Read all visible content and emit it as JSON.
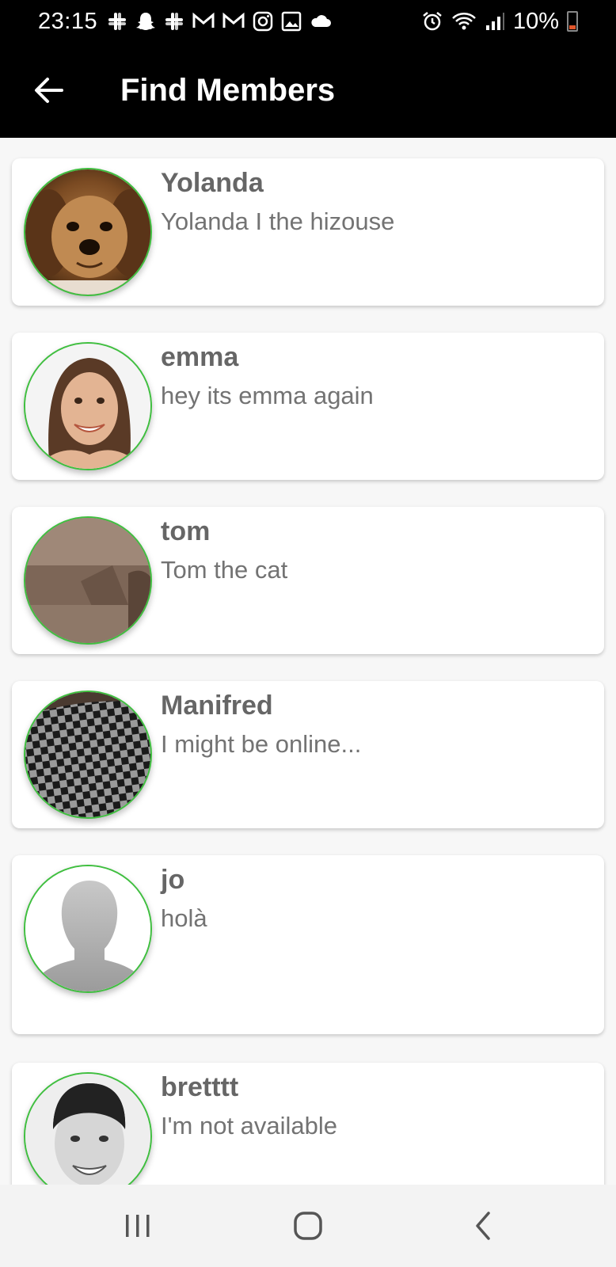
{
  "status_bar": {
    "time": "23:15",
    "battery_percent": "10%"
  },
  "app_bar": {
    "title": "Find Members"
  },
  "members": [
    {
      "name": "Yolanda",
      "status": "Yolanda I the hizouse",
      "avatar": "dog-photo"
    },
    {
      "name": "emma",
      "status": "hey its emma again",
      "avatar": "woman-photo"
    },
    {
      "name": "tom",
      "status": "Tom the cat",
      "avatar": "sofa-photo"
    },
    {
      "name": "Manifred",
      "status": "I might be online...",
      "avatar": "checkerboard-photo"
    },
    {
      "name": "jo",
      "status": "holà",
      "avatar": "default-silhouette"
    },
    {
      "name": "bretttt",
      "status": "I'm not available",
      "avatar": "man-photo"
    }
  ],
  "colors": {
    "avatar_ring": "#3fbf3f",
    "name_text": "#666666",
    "status_text": "#737373",
    "app_bar_bg": "#000000"
  }
}
